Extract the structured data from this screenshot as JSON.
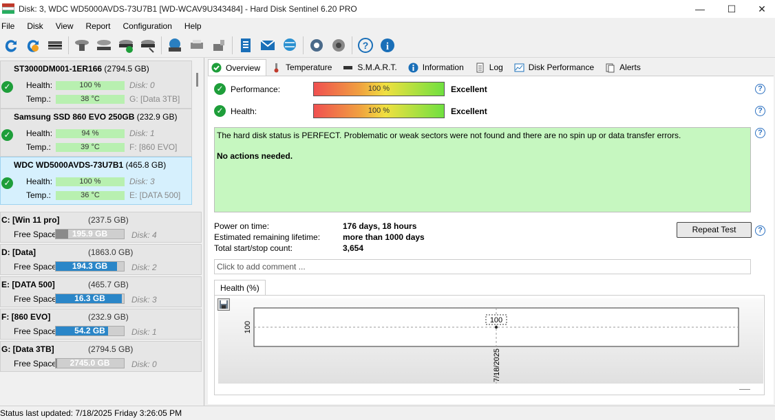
{
  "window": {
    "title": "Disk: 3, WDC WD5000AVDS-73U7B1 [WD-WCAV9U343484]  -  Hard Disk Sentinel 6.20 PRO",
    "minimize": "—",
    "maximize": "☐",
    "close": "✕"
  },
  "menu": [
    "File",
    "Disk",
    "View",
    "Report",
    "Configuration",
    "Help"
  ],
  "toolbar": [
    "refresh-icon",
    "refresh-warning-icon",
    "drive-icon",
    "disk-test-icon",
    "disk-surface-icon",
    "disk-ok-icon",
    "disk-scan-icon",
    "network-drive-icon",
    "printer-icon",
    "usb-drive-icon",
    "report-icon",
    "email-icon",
    "web-report-icon",
    "settings-icon",
    "sound-icon",
    "help-icon",
    "info-icon"
  ],
  "disks": [
    {
      "name": "ST3000DM001-1ER166",
      "size": "(2794.5 GB)",
      "health_label": "Health:",
      "health": "100 %",
      "disk": "Disk: 0",
      "temp_label": "Temp.:",
      "temp": "38 °C",
      "volume": "G: [Data 3TB]"
    },
    {
      "name": "Samsung SSD 860 EVO 250GB",
      "size": "(232.9 GB)",
      "health_label": "Health:",
      "health": "94 %",
      "disk": "Disk: 1",
      "temp_label": "Temp.:",
      "temp": "39 °C",
      "volume": "F: [860 EVO]"
    },
    {
      "name": "WDC WD5000AVDS-73U7B1",
      "size": "(465.8 GB)",
      "health_label": "Health:",
      "health": "100 %",
      "disk": "Disk: 3",
      "temp_label": "Temp.:",
      "temp": "36 °C",
      "volume": "E: [DATA 500]"
    }
  ],
  "volumes": [
    {
      "name": "C: [Win 11 pro]",
      "size": "(237.5 GB)",
      "free_label": "Free Space",
      "free": "195.9 GB",
      "used_fraction": 0.18,
      "disk": "Disk: 4",
      "color": "#8a8a8a"
    },
    {
      "name": "D: [Data]",
      "size": "(1863.0 GB)",
      "free_label": "Free Space",
      "free": "194.3 GB",
      "used_fraction": 0.9,
      "disk": "Disk: 2",
      "color": "#2a86c8"
    },
    {
      "name": "E: [DATA 500]",
      "size": "(465.7 GB)",
      "free_label": "Free Space",
      "free": "16.3 GB",
      "used_fraction": 0.97,
      "disk": "Disk: 3",
      "color": "#2a86c8"
    },
    {
      "name": "F: [860 EVO]",
      "size": "(232.9 GB)",
      "free_label": "Free Space",
      "free": "54.2 GB",
      "used_fraction": 0.77,
      "disk": "Disk: 1",
      "color": "#2a86c8"
    },
    {
      "name": "G: [Data 3TB]",
      "size": "(2794.5 GB)",
      "free_label": "Free Space",
      "free": "2745.0 GB",
      "used_fraction": 0.02,
      "disk": "Disk: 0",
      "color": "#8a8a8a"
    }
  ],
  "tabs": [
    "Overview",
    "Temperature",
    "S.M.A.R.T.",
    "Information",
    "Log",
    "Disk Performance",
    "Alerts"
  ],
  "overview": {
    "performance_label": "Performance:",
    "performance": "100 %",
    "performance_rating": "Excellent",
    "health_label": "Health:",
    "health": "100 %",
    "health_rating": "Excellent",
    "status_text": "The hard disk status is PERFECT. Problematic or weak sectors were not found and there are no spin up or data transfer errors.",
    "action_text": "No actions needed.",
    "power_on_label": "Power on time:",
    "power_on": "176 days, 18 hours",
    "lifetime_label": "Estimated remaining lifetime:",
    "lifetime": "more than 1000 days",
    "startstop_label": "Total start/stop count:",
    "startstop": "3,654",
    "repeat_test": "Repeat Test",
    "comment_placeholder": "Click to add comment ...",
    "help": "?"
  },
  "chart_data": {
    "type": "line",
    "title": "Health (%)",
    "x": [
      "7/18/2025"
    ],
    "series": [
      {
        "values": [
          100
        ]
      }
    ],
    "data_labels": [
      "100"
    ],
    "ytick": "100"
  },
  "status_bar": "Status last updated: 7/18/2025 Friday 3:26:05 PM"
}
